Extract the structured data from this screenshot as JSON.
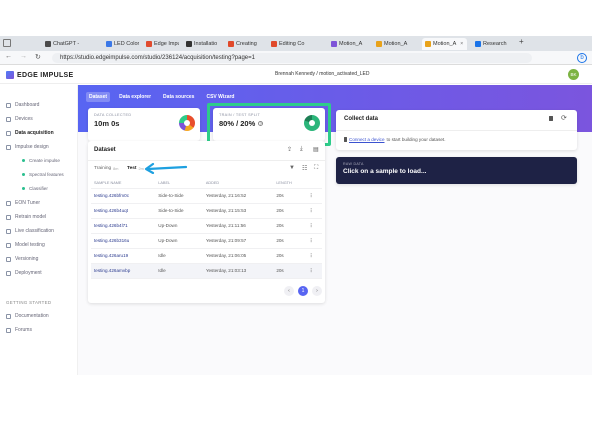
{
  "browser": {
    "tabs": [
      {
        "label": "ChatGPT - ",
        "color": "#4a4a4a"
      },
      {
        "label": "LED Color",
        "color": "#3b78e7"
      },
      {
        "label": "Edge Impu",
        "color": "#e04b2e"
      },
      {
        "label": "Installatio",
        "color": "#333333"
      },
      {
        "label": "Creating ",
        "color": "#e0492a"
      },
      {
        "label": "Editing Co",
        "color": "#e0492a"
      },
      {
        "label": "Motion_A",
        "color": "#7e54d8"
      },
      {
        "label": "Motion_A",
        "color": "#e8a21a"
      },
      {
        "label": "Motion_A",
        "color": "#e8a21a"
      },
      {
        "label": "Research ",
        "color": "#1a73e8"
      }
    ],
    "url": "https://studio.edgeimpulse.com/studio/236124/acquisition/testing?page=1",
    "new_tab": "+"
  },
  "app": {
    "logo": "EDGE IMPULSE",
    "user_project": "Brennah Kennedy / motion_activated_LED",
    "avatar": "BK"
  },
  "sidebar": {
    "items": [
      {
        "label": "Dashboard"
      },
      {
        "label": "Devices"
      },
      {
        "label": "Data acquisition"
      },
      {
        "label": "Impulse design"
      }
    ],
    "sub_items": [
      {
        "label": "Create impulse"
      },
      {
        "label": "Spectral features"
      },
      {
        "label": "Classifier"
      }
    ],
    "items2": [
      {
        "label": "EON Tuner"
      },
      {
        "label": "Retrain model"
      },
      {
        "label": "Live classification"
      },
      {
        "label": "Model testing"
      },
      {
        "label": "Versioning"
      },
      {
        "label": "Deployment"
      }
    ],
    "section": "GETTING STARTED",
    "items3": [
      {
        "label": "Documentation"
      },
      {
        "label": "Forums"
      }
    ]
  },
  "tabs": [
    "Dataset",
    "Data explorer",
    "Data sources",
    "CSV Wizard"
  ],
  "stats": {
    "collected_label": "DATA COLLECTED",
    "collected_value": "10m 0s",
    "split_label": "TRAIN / TEST SPLIT",
    "split_value": "80% / 20%",
    "split_info": "?"
  },
  "collect": {
    "title": "Collect data",
    "link": "Connect a device",
    "text": " to start building your dataset."
  },
  "raw": {
    "label": "RAW DATA",
    "text": "Click on a sample to load..."
  },
  "dataset": {
    "title": "Dataset",
    "training_label": "Training",
    "training_count": "8m",
    "test_label": "Test",
    "test_count": "2m",
    "columns": [
      "SAMPLE NAME",
      "LABEL",
      "ADDED",
      "LENGTH",
      ""
    ],
    "rows": [
      {
        "name": "testing.426bfm0c",
        "label": "Side-to-Side",
        "added": "Yesterday, 21:16:52",
        "length": "20s"
      },
      {
        "name": "testing.426b4uqt",
        "label": "Side-to-Side",
        "added": "Yesterday, 21:15:53",
        "length": "20s"
      },
      {
        "name": "testing.426b4l71",
        "label": "Up-Down",
        "added": "Yesterday, 21:11:56",
        "length": "20s"
      },
      {
        "name": "testing.426b316u",
        "label": "Up-Down",
        "added": "Yesterday, 21:09:57",
        "length": "20s"
      },
      {
        "name": "testing.426aru19",
        "label": "Idle",
        "added": "Yesterday, 21:06:05",
        "length": "20s"
      },
      {
        "name": "testing.426amvbp",
        "label": "Idle",
        "added": "Yesterday, 21:03:13",
        "length": "20s"
      }
    ],
    "page": "1"
  },
  "colors": {
    "accent": "#5865f2",
    "highlight": "#2ecc8a",
    "arrow": "#1ea0e0"
  }
}
